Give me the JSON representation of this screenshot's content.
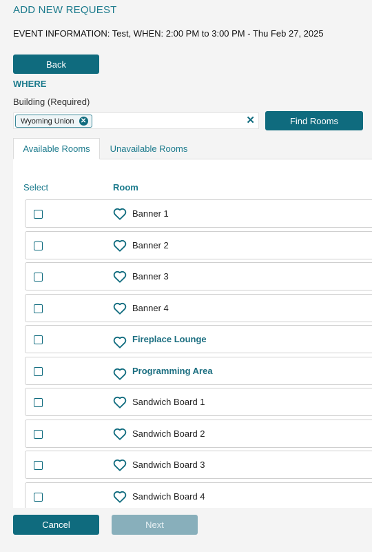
{
  "header": {
    "title": "ADD NEW REQUEST",
    "event_info": "EVENT INFORMATION: Test, WHEN: 2:00 PM to 3:00 PM - Thu Feb 27, 2025"
  },
  "buttons": {
    "back": "Back",
    "find_rooms": "Find Rooms",
    "cancel": "Cancel",
    "next": "Next"
  },
  "where": {
    "heading": "WHERE",
    "building_label": "Building (Required)",
    "selected_building": "Wyoming Union",
    "chip_remove_glyph": "✕",
    "clear_glyph": "✕"
  },
  "tabs": [
    {
      "label": "Available Rooms",
      "active": true
    },
    {
      "label": "Unavailable Rooms",
      "active": false
    }
  ],
  "table": {
    "col_select": "Select",
    "col_room": "Room",
    "rows": [
      {
        "name": "Banner 1",
        "bold": false,
        "checked": false
      },
      {
        "name": "Banner 2",
        "bold": false,
        "checked": false
      },
      {
        "name": "Banner 3",
        "bold": false,
        "checked": false
      },
      {
        "name": "Banner 4",
        "bold": false,
        "checked": false
      },
      {
        "name": "Fireplace Lounge",
        "bold": true,
        "checked": false
      },
      {
        "name": "Programming Area",
        "bold": true,
        "checked": false
      },
      {
        "name": "Sandwich Board 1",
        "bold": false,
        "checked": false
      },
      {
        "name": "Sandwich Board 2",
        "bold": false,
        "checked": false
      },
      {
        "name": "Sandwich Board 3",
        "bold": false,
        "checked": false
      },
      {
        "name": "Sandwich Board 4",
        "bold": false,
        "checked": false
      }
    ]
  },
  "icons": {
    "favorite": "heart-outline-icon",
    "chip_remove": "close-circle-icon",
    "clear": "close-icon"
  },
  "colors": {
    "accent": "#1b7a8c",
    "primary_button": "#0f6b7e",
    "disabled_button": "#88afbb",
    "background": "#f4f4f4"
  }
}
